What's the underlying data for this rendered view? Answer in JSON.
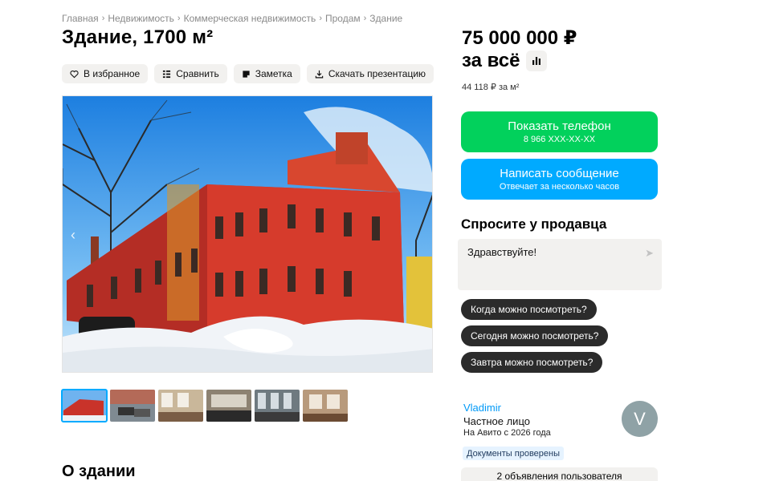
{
  "breadcrumb": [
    "Главная",
    "Недвижимость",
    "Коммерческая недвижимость",
    "Продам",
    "Здание"
  ],
  "title": "Здание, 1700 м²",
  "actions": {
    "favorite": "В избранное",
    "compare": "Сравнить",
    "note": "Заметка",
    "download": "Скачать презентацию"
  },
  "price": {
    "amount": "75 000 000 ₽",
    "suffix": "за всё",
    "per_sqm": "44 118 ₽ за м²"
  },
  "contact": {
    "phone_label": "Показать телефон",
    "phone_number": "8 966 XXX-XX-XX",
    "message_label": "Написать сообщение",
    "message_sub": "Отвечает за несколько часов"
  },
  "ask": {
    "title": "Спросите у продавца",
    "message": "Здравствуйте!",
    "chips": [
      "Когда можно посмотреть?",
      "Сегодня можно посмотреть?",
      "Завтра можно посмотреть?"
    ]
  },
  "seller": {
    "name": "Vladimir",
    "type": "Частное лицо",
    "since": "На Авито с 2026 года",
    "avatar_letter": "V",
    "verified": "Документы проверены",
    "listings": "2 объявления пользователя"
  },
  "section": {
    "about": "О здании"
  },
  "colors": {
    "green": "#02d15c",
    "blue": "#00aaff",
    "chip": "#2b2b2b",
    "link": "#0099f7"
  }
}
